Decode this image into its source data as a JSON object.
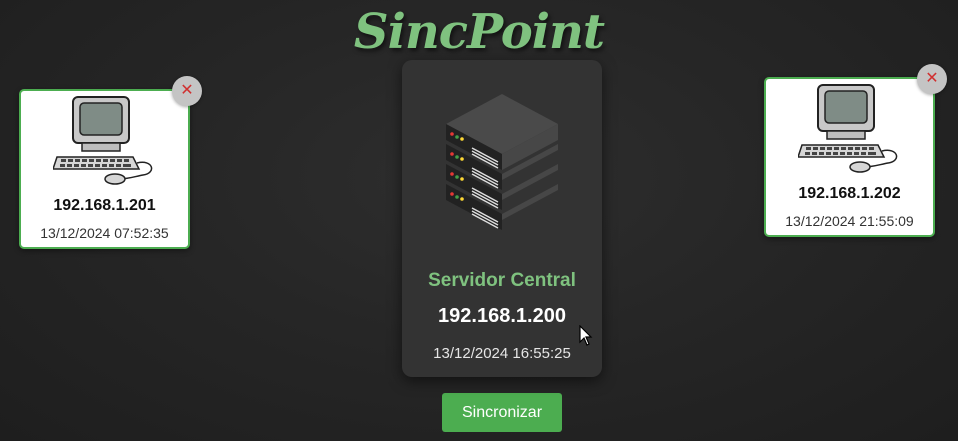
{
  "app": {
    "logo_text": "SincPoint"
  },
  "server": {
    "icon": "server-rack-icon",
    "title": "Servidor Central",
    "ip": "192.168.1.200",
    "timestamp": "13/12/2024 16:55:25"
  },
  "clients": [
    {
      "icon": "desktop-computer-icon",
      "ip": "192.168.1.201",
      "timestamp": "13/12/2024 07:52:35",
      "remove_label": "✕"
    },
    {
      "icon": "desktop-computer-icon",
      "ip": "192.168.1.202",
      "timestamp": "13/12/2024 21:55:09",
      "remove_label": "✕"
    }
  ],
  "actions": {
    "sync_label": "Sincronizar"
  },
  "colors": {
    "accent_green": "#7fc27f",
    "button_green": "#4cad50",
    "background": "#262626",
    "card_dark": "#333333",
    "close_red": "#d03030"
  }
}
